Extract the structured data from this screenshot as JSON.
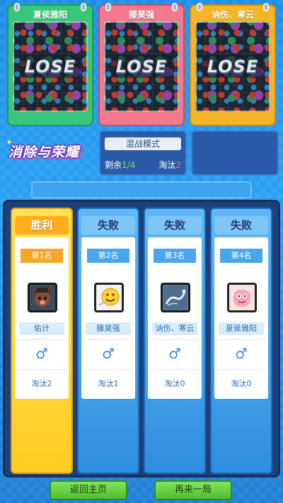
{
  "boards": [
    {
      "name": "夏侯雅阳",
      "result": "LOSE"
    },
    {
      "name": "滕昊强",
      "result": "LOSE"
    },
    {
      "name": "讷伤、寒云",
      "result": "LOSE"
    }
  ],
  "logo": {
    "text": "消除与荣耀",
    "icon": "sparkle-icon"
  },
  "mode": {
    "title": "混战模式",
    "remain_label": "剩余",
    "remain_value": "1/4",
    "eliminated_label": "淘汰",
    "eliminated_value": "2"
  },
  "results": [
    {
      "status": "胜利",
      "rank": "第1名",
      "avatar": "bear-avatar-icon",
      "name": "佑计",
      "gender": "♂",
      "kills": "淘汰2"
    },
    {
      "status": "失败",
      "rank": "第2名",
      "avatar": "smiley-avatar-icon",
      "name": "滕昊强",
      "gender": "♂",
      "kills": "淘汰1"
    },
    {
      "status": "失败",
      "rank": "第3名",
      "avatar": "dragon-avatar-icon",
      "name": "讷伤、寒云",
      "gender": "♂",
      "kills": "淘汰0"
    },
    {
      "status": "失败",
      "rank": "第4名",
      "avatar": "starfish-avatar-icon",
      "name": "夏侯雅阳",
      "gender": "♂",
      "kills": "淘汰0"
    }
  ],
  "buttons": {
    "home": "返回主页",
    "again": "再来一局"
  },
  "colors": {
    "win": "#ffcc22",
    "lose": "#2f8fe0",
    "button": "#4fbf2d"
  }
}
